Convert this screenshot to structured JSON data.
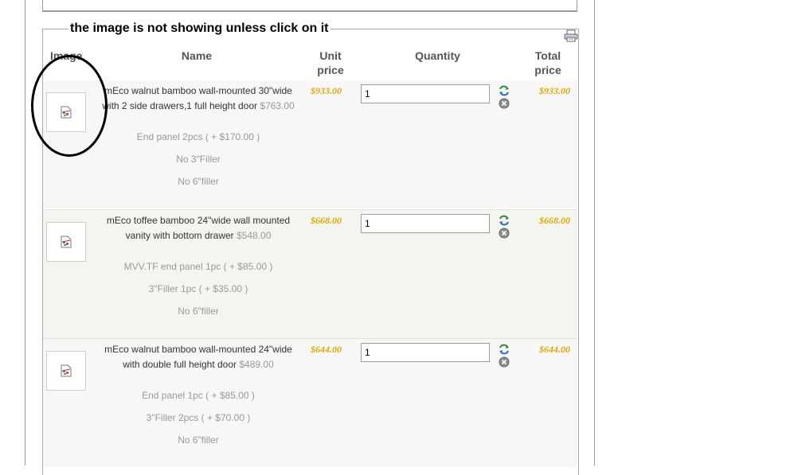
{
  "annotation": {
    "text": "the image is not showing unless click on it"
  },
  "table": {
    "headers": {
      "image": "Image",
      "name": "Name",
      "unit_price": "Unit price",
      "quantity": "Quantity",
      "total_price": "Total price"
    }
  },
  "items": [
    {
      "name": "mEco walnut bamboo wall-mounted 30\"wide with 2 side drawers,1 full height door",
      "base_price": "$763.00",
      "options": [
        "End panel 2pcs ( + $170.00 )",
        "No 3\"Filler",
        "No 6\"filler"
      ],
      "unit_price": "$933.00",
      "quantity": "1",
      "total_price": "$933.00"
    },
    {
      "name": "mEco toffee bamboo 24\"wide wall mounted vanity with bottom drawer",
      "base_price": "$548.00",
      "options": [
        "MVV.TF end panel 1pc ( + $85.00 )",
        "3\"Filler 1pc ( + $35.00 )",
        "No 6\"filler"
      ],
      "unit_price": "$668.00",
      "quantity": "1",
      "total_price": "$668.00"
    },
    {
      "name": "mEco walnut bamboo wall-mounted 24\"wide with double full height door",
      "base_price": "$489.00",
      "options": [
        "End panel 1pc ( + $85.00 )",
        "3\"Filler 2pcs ( + $70.00 )",
        "No 6\"filler"
      ],
      "unit_price": "$644.00",
      "quantity": "1",
      "total_price": "$644.00"
    }
  ],
  "icons": {
    "print": "printer-icon",
    "thumbnail": "broken-image-icon",
    "update": "refresh-icon",
    "remove": "remove-icon"
  },
  "colors": {
    "price": "#e0a800",
    "muted": "#999999",
    "annotation": "#000000"
  }
}
